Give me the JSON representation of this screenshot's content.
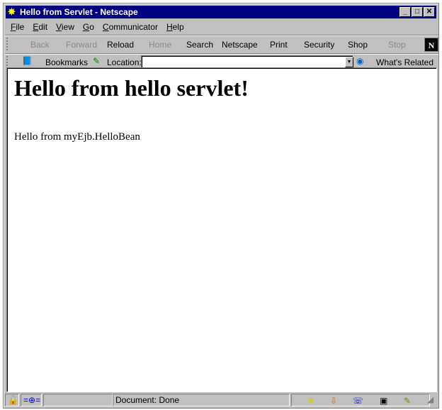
{
  "window": {
    "title": "Hello from Servlet - Netscape"
  },
  "menu": [
    "File",
    "Edit",
    "View",
    "Go",
    "Communicator",
    "Help"
  ],
  "nav": [
    {
      "label": "Back",
      "enabled": false
    },
    {
      "label": "Forward",
      "enabled": false
    },
    {
      "label": "Reload",
      "enabled": true
    },
    {
      "label": "Home",
      "enabled": false
    },
    {
      "label": "Search",
      "enabled": true
    },
    {
      "label": "Netscape",
      "enabled": true
    },
    {
      "label": "Print",
      "enabled": true
    },
    {
      "label": "Security",
      "enabled": true
    },
    {
      "label": "Shop",
      "enabled": true
    },
    {
      "label": "Stop",
      "enabled": false
    }
  ],
  "location": {
    "bookmarks": "Bookmarks",
    "label": "Location:",
    "value": "",
    "related": "What's Related"
  },
  "page": {
    "heading": "Hello from hello servlet!",
    "text": "Hello from myEjb.HelloBean"
  },
  "status": {
    "text": "Document: Done"
  },
  "colors": {
    "titlebar": "#000080",
    "chrome": "#c0c0c0"
  }
}
